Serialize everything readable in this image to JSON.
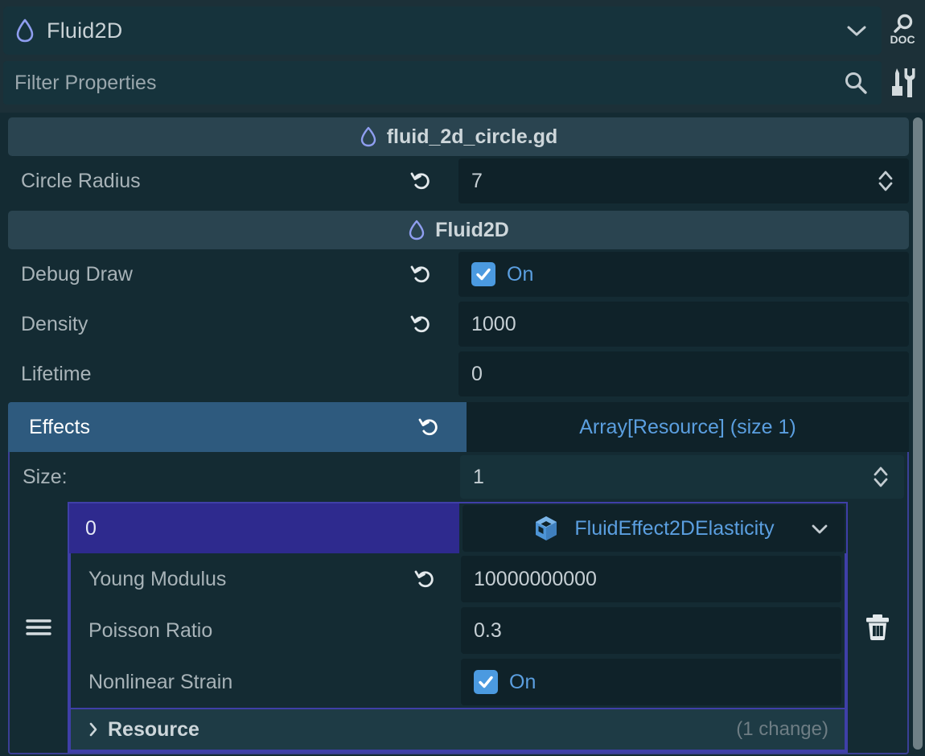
{
  "header": {
    "node_name": "Fluid2D",
    "node_icon": "fluid-drop-icon",
    "chevron_icon": "chevron-down-icon",
    "doc_button_label": "DOC",
    "doc_icon": "search-documentation-icon",
    "tools_icon": "object-tools-icon"
  },
  "search": {
    "placeholder": "Filter Properties",
    "value": "",
    "icon": "search-icon"
  },
  "script_section": {
    "title": "fluid_2d_circle.gd",
    "icon": "script-drop-icon",
    "properties": [
      {
        "label": "Circle Radius",
        "value": "7",
        "type": "number",
        "has_revert": true,
        "has_spinner": true
      }
    ]
  },
  "class_section": {
    "title": "Fluid2D",
    "icon": "fluid-drop-icon",
    "properties": [
      {
        "label": "Debug Draw",
        "value": "On",
        "type": "checkbox",
        "checked": true,
        "has_revert": true
      },
      {
        "label": "Density",
        "value": "1000",
        "type": "number",
        "has_revert": true
      },
      {
        "label": "Lifetime",
        "value": "0",
        "type": "number",
        "has_revert": false
      }
    ]
  },
  "effects": {
    "label": "Effects",
    "value_label": "Array[Resource] (size 1)",
    "selected": true,
    "has_revert": true,
    "size_label": "Size:",
    "size_value": "1",
    "element": {
      "index": "0",
      "type_name": "FluidEffect2DElasticity",
      "type_icon": "resource-cube-icon",
      "dropdown_icon": "chevron-down-icon",
      "drag_handle_icon": "drag-handle-icon",
      "delete_icon": "trash-icon",
      "properties": [
        {
          "label": "Young Modulus",
          "value": "10000000000",
          "type": "number",
          "has_revert": true
        },
        {
          "label": "Poisson Ratio",
          "value": "0.3",
          "type": "number",
          "has_revert": false
        },
        {
          "label": "Nonlinear Strain",
          "value": "On",
          "type": "checkbox",
          "checked": true,
          "has_revert": false
        }
      ],
      "footer": {
        "label": "Resource",
        "changes": "(1 change)",
        "expand_icon": "chevron-right-icon"
      }
    }
  },
  "colors": {
    "accent_blue": "#5b9fe0",
    "selection_blue": "#2e5a7e",
    "array_border": "#3f3fa8",
    "index_badge": "#2e2a8e",
    "panel_bg": "#142b33",
    "field_bg": "#0f2229",
    "checkbox_fill": "#4b9ae0"
  }
}
